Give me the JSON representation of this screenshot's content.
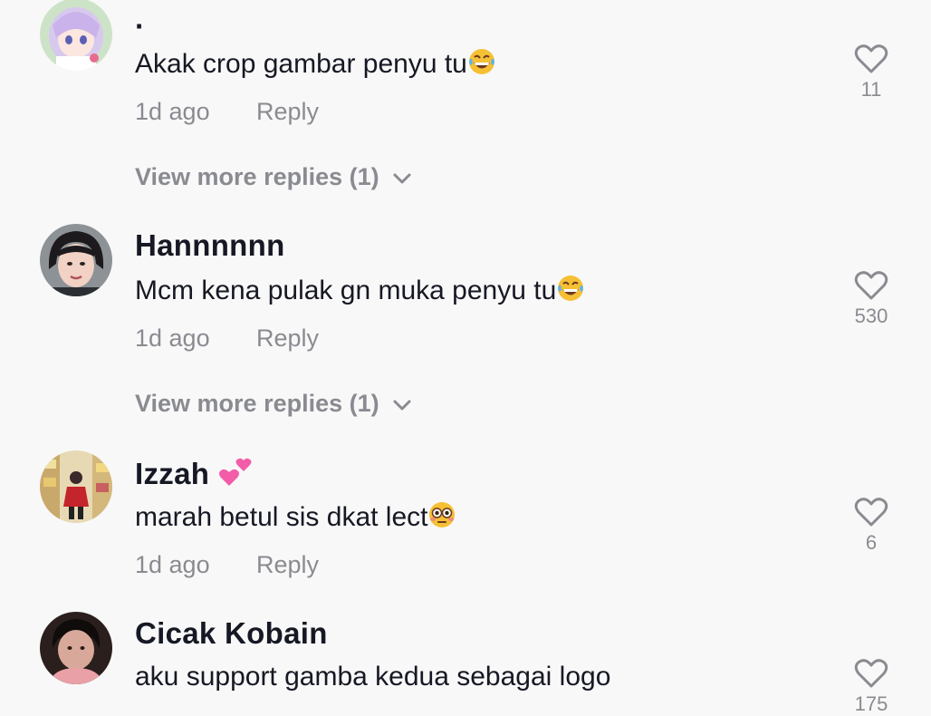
{
  "comments": [
    {
      "username": "·",
      "text": "Akak crop gambar penyu tu",
      "emoji": "laughing-tears",
      "time": "1d ago",
      "reply_label": "Reply",
      "likes": "11",
      "view_more": "View more replies (1)"
    },
    {
      "username": "Hannnnnn",
      "text": "Mcm kena pulak gn muka penyu tu",
      "emoji": "laughing-tears",
      "time": "1d ago",
      "reply_label": "Reply",
      "likes": "530",
      "view_more": "View more replies (1)"
    },
    {
      "username": "Izzah",
      "username_emoji": "two-hearts",
      "text": "marah betul sis dkat lect",
      "emoji": "flushed-face",
      "time": "1d ago",
      "reply_label": "Reply",
      "likes": "6"
    },
    {
      "username": "Cicak Kobain",
      "text": "aku support gamba kedua sebagai logo",
      "likes": "175"
    }
  ],
  "colors": {
    "background": "#f8f8f8",
    "primary_text": "#161823",
    "secondary_text": "#8a8b91"
  }
}
